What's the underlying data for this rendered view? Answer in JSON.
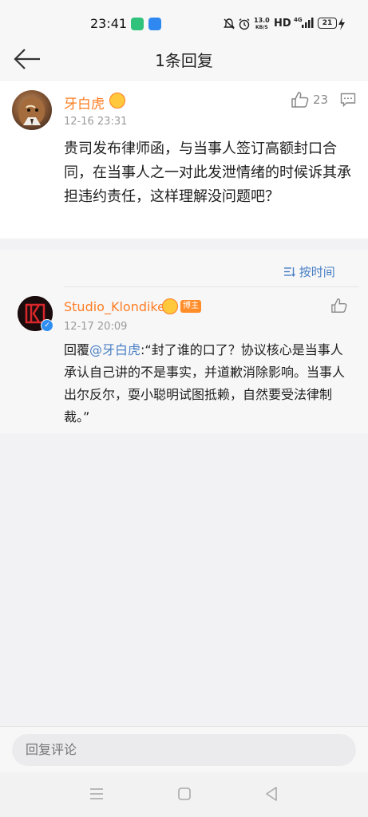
{
  "status_bar": {
    "time": "23:41",
    "net_speed_value": "13.0",
    "net_speed_unit": "KB/S",
    "hd": "HD",
    "battery": "21",
    "icons": [
      "mute-icon",
      "alarm-icon",
      "4g-signal-icon",
      "battery-icon",
      "charging-icon"
    ]
  },
  "header": {
    "title": "1条回复",
    "back_icon": "arrow-left-icon"
  },
  "main_comment": {
    "author": "牙白虎",
    "time": "12-16 23:31",
    "like_count": "23",
    "content": "贵司发布律师函，与当事人签订高额封口合同，在当事人之一对此发泄情绪的时候诉其承担违约责任，这样理解没问题吧？"
  },
  "sort": {
    "label": "按时间",
    "icon": "sort-icon"
  },
  "reply": {
    "author": "Studio_Klondike",
    "tag": "博主",
    "time": "12-17 20:09",
    "prefix": "回覆",
    "mention": "@牙白虎",
    "content": ":“封了谁的口了？协议核心是当事人承认自己讲的不是事实，并道歉消除影响。当事人出尔反尔，耍小聪明试图抵赖，自然要受法律制裁。”"
  },
  "input": {
    "placeholder": "回复评论"
  },
  "colors": {
    "accent_orange": "#ff7d22",
    "link_blue": "#4a7fc4",
    "page_bg": "#f2f2f4"
  }
}
